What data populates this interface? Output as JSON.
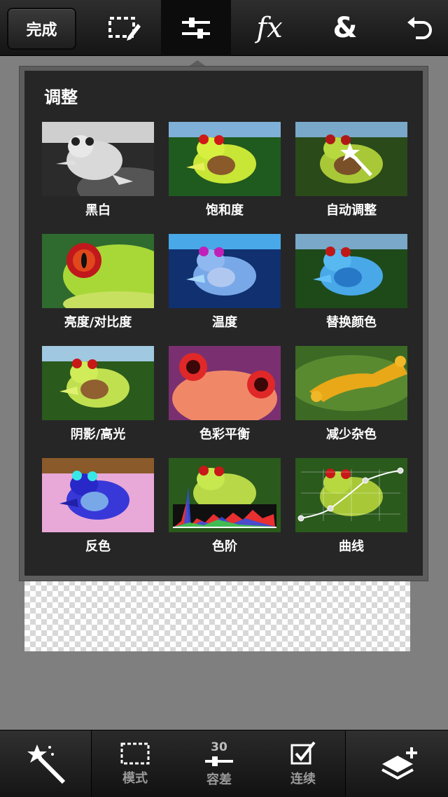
{
  "toolbar": {
    "done_label": "完成",
    "icons": [
      "selection-edit-icon",
      "adjust-sliders-icon",
      "fx-effects-icon",
      "blend-ampersand-icon",
      "undo-icon"
    ],
    "fx_glyph": "fx",
    "amp_glyph": "&"
  },
  "adjust_panel": {
    "title": "调整",
    "items": [
      {
        "label": "黑白"
      },
      {
        "label": "饱和度"
      },
      {
        "label": "自动调整"
      },
      {
        "label": "亮度/对比度"
      },
      {
        "label": "温度"
      },
      {
        "label": "替换颜色"
      },
      {
        "label": "阴影/高光"
      },
      {
        "label": "色彩平衡"
      },
      {
        "label": "减少杂色"
      },
      {
        "label": "反色"
      },
      {
        "label": "色阶"
      },
      {
        "label": "曲线"
      }
    ]
  },
  "bottom_bar": {
    "mode_label": "模式",
    "tolerance_value": "30",
    "tolerance_label": "容差",
    "contiguous_label": "连续",
    "icons": [
      "magic-wand-icon",
      "marquee-mode-icon",
      "tolerance-slider-icon",
      "checkbox-icon",
      "layers-add-icon"
    ]
  },
  "colors": {
    "toolbar_bg": "#1e1e1e",
    "panel_bg": "#262626",
    "frog_green": "#9acd32",
    "frog_eye": "#c81e1e"
  }
}
